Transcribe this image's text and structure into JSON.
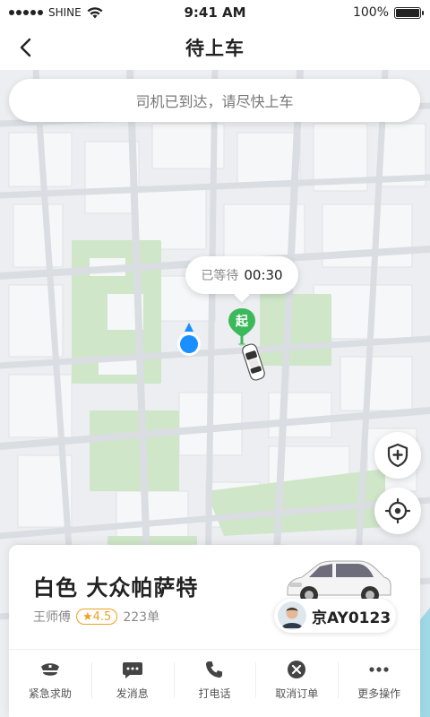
{
  "status_bar": {
    "carrier": "SHINE",
    "time": "9:41 AM",
    "battery": "100%"
  },
  "nav": {
    "title": "待上车",
    "back_icon": "chevron-left-icon"
  },
  "notice": {
    "text": "司机已到达，请尽快上车"
  },
  "map": {
    "wait_label": "已等待",
    "wait_time": "00:30",
    "start_pin_label": "起"
  },
  "map_controls": {
    "safety_icon": "shield-plus-icon",
    "locate_icon": "crosshair-icon"
  },
  "ride": {
    "car_description": "白色 大众帕萨特",
    "driver_name": "王师傅",
    "rating": "★4.5",
    "orders": "223单",
    "plate": "京AY0123"
  },
  "actions": [
    {
      "label": "紧急求助",
      "icon": "police-icon"
    },
    {
      "label": "发消息",
      "icon": "message-icon"
    },
    {
      "label": "打电话",
      "icon": "phone-icon"
    },
    {
      "label": "取消订单",
      "icon": "cancel-icon"
    },
    {
      "label": "更多操作",
      "icon": "more-icon"
    }
  ],
  "colors": {
    "accent": "#1a8fff",
    "pin_green": "#3cba5b",
    "rating": "#f0a020",
    "park_green": "#cfe6c9",
    "water": "#9fd9e8"
  }
}
